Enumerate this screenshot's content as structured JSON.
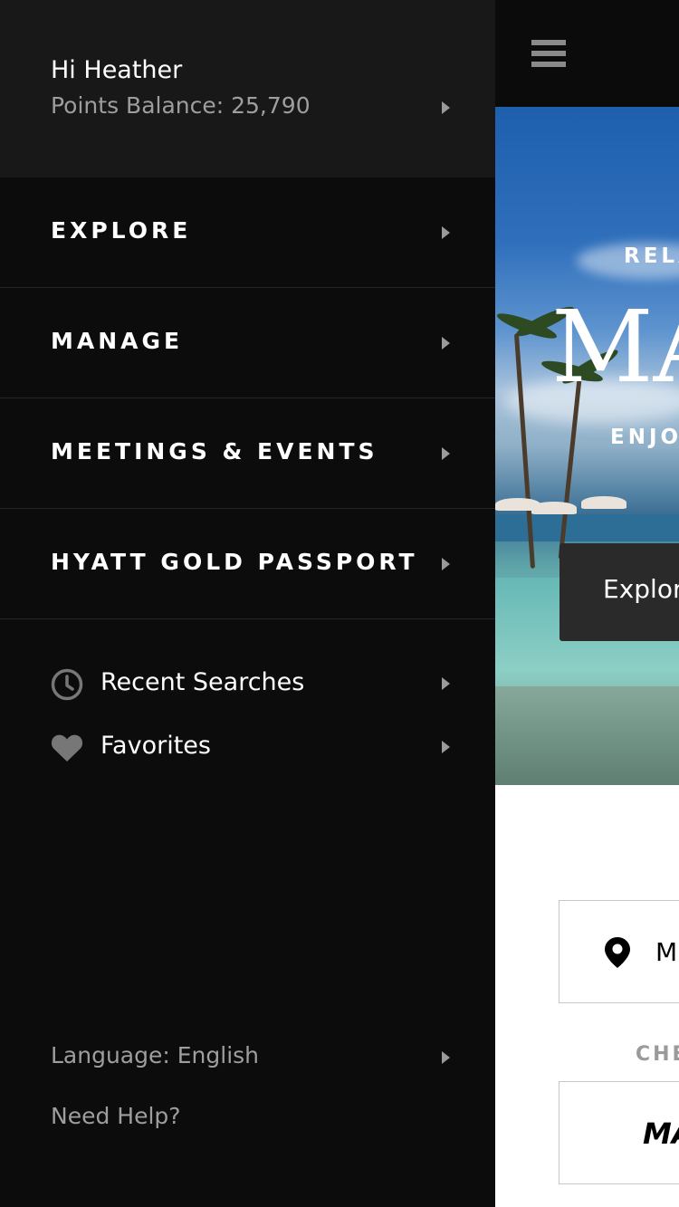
{
  "profile": {
    "greeting": "Hi Heather",
    "points": "Points Balance: 25,790"
  },
  "nav": {
    "items": [
      {
        "label": "EXPLORE"
      },
      {
        "label": "MANAGE"
      },
      {
        "label": "MEETINGS & EVENTS"
      },
      {
        "label": "HYATT GOLD PASSPORT"
      }
    ]
  },
  "sub_nav": {
    "recent_searches": "Recent Searches",
    "favorites": "Favorites"
  },
  "footer": {
    "language": "Language: English",
    "help": "Need Help?"
  },
  "main": {
    "hero": {
      "kicker": "RELA",
      "title": "MA",
      "subtitle": "ENJO",
      "explore_button": "Explor"
    },
    "location_value": "M",
    "checkin_label": "CHE",
    "date_value": "MA"
  },
  "colors": {
    "drawer_bg": "#0c0c0c",
    "profile_bg": "#181818",
    "text_primary": "#ffffff",
    "text_secondary": "#9e9e9e"
  }
}
